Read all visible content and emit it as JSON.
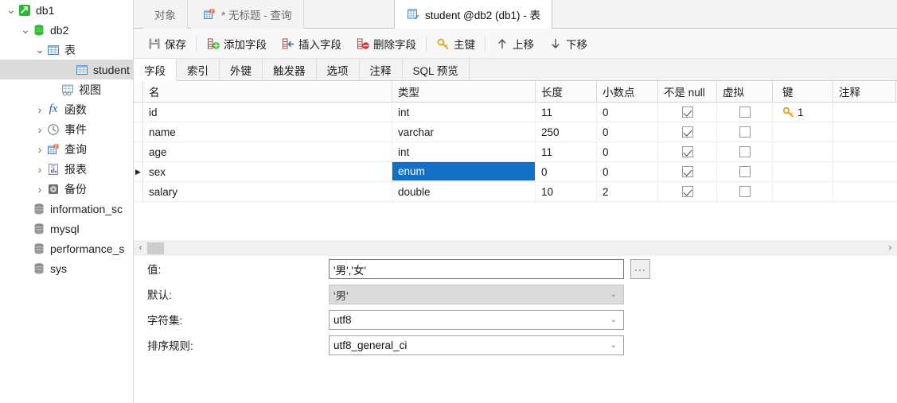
{
  "sidebar": {
    "items": [
      {
        "label": "db1",
        "icon": "connection-icon",
        "indent": 0,
        "twisty": "down",
        "selected": false
      },
      {
        "label": "db2",
        "icon": "database-icon",
        "indent": 1,
        "twisty": "down",
        "selected": false
      },
      {
        "label": "表",
        "icon": "table-folder-icon",
        "indent": 2,
        "twisty": "down",
        "selected": false
      },
      {
        "label": "student",
        "icon": "table-icon",
        "indent": 4,
        "twisty": "none",
        "selected": true
      },
      {
        "label": "视图",
        "icon": "view-icon",
        "indent": 3,
        "twisty": "none",
        "selected": false
      },
      {
        "label": "函数",
        "icon": "function-icon",
        "indent": 2,
        "twisty": "right",
        "selected": false
      },
      {
        "label": "事件",
        "icon": "event-clock-icon",
        "indent": 2,
        "twisty": "right",
        "selected": false
      },
      {
        "label": "查询",
        "icon": "query-icon",
        "indent": 2,
        "twisty": "right",
        "selected": false
      },
      {
        "label": "报表",
        "icon": "report-icon",
        "indent": 2,
        "twisty": "right",
        "selected": false
      },
      {
        "label": "备份",
        "icon": "backup-icon",
        "indent": 2,
        "twisty": "right",
        "selected": false
      },
      {
        "label": "information_sc",
        "icon": "database-gray-icon",
        "indent": 1,
        "twisty": "none",
        "selected": false
      },
      {
        "label": "mysql",
        "icon": "database-gray-icon",
        "indent": 1,
        "twisty": "none",
        "selected": false
      },
      {
        "label": "performance_s",
        "icon": "database-gray-icon",
        "indent": 1,
        "twisty": "none",
        "selected": false
      },
      {
        "label": "sys",
        "icon": "database-gray-icon",
        "indent": 1,
        "twisty": "none",
        "selected": false
      }
    ]
  },
  "tabs": [
    {
      "label": "对象",
      "icon": "none",
      "active": false
    },
    {
      "label": "* 无标题 - 查询",
      "icon": "query-icon",
      "active": false
    },
    {
      "label": "student @db2 (db1) - 表",
      "icon": "table-design-icon",
      "active": true
    }
  ],
  "toolbar": {
    "buttons": [
      {
        "label": "保存",
        "icon": "save-icon"
      },
      {
        "label": "添加字段",
        "icon": "add-field-icon"
      },
      {
        "label": "插入字段",
        "icon": "insert-field-icon"
      },
      {
        "label": "删除字段",
        "icon": "delete-field-icon"
      },
      {
        "label": "主键",
        "icon": "key-icon"
      },
      {
        "label": "上移",
        "icon": "arrow-up-icon"
      },
      {
        "label": "下移",
        "icon": "arrow-down-icon"
      }
    ]
  },
  "subtabs": [
    {
      "label": "字段",
      "active": true
    },
    {
      "label": "索引",
      "active": false
    },
    {
      "label": "外键",
      "active": false
    },
    {
      "label": "触发器",
      "active": false
    },
    {
      "label": "选项",
      "active": false
    },
    {
      "label": "注释",
      "active": false
    },
    {
      "label": "SQL 预览",
      "active": false
    }
  ],
  "grid": {
    "columns": [
      "名",
      "类型",
      "长度",
      "小数点",
      "不是 null",
      "虚拟",
      "键",
      "注释"
    ],
    "rows": [
      {
        "marker": "",
        "name": "id",
        "type": "int",
        "length": "11",
        "decimals": "0",
        "not_null": true,
        "virtual": false,
        "key": "1",
        "comment": "",
        "selected_type": false
      },
      {
        "marker": "",
        "name": "name",
        "type": "varchar",
        "length": "250",
        "decimals": "0",
        "not_null": true,
        "virtual": false,
        "key": "",
        "comment": "",
        "selected_type": false
      },
      {
        "marker": "",
        "name": "age",
        "type": "int",
        "length": "11",
        "decimals": "0",
        "not_null": true,
        "virtual": false,
        "key": "",
        "comment": "",
        "selected_type": false
      },
      {
        "marker": "▶",
        "name": "sex",
        "type": "enum",
        "length": "0",
        "decimals": "0",
        "not_null": true,
        "virtual": false,
        "key": "",
        "comment": "",
        "selected_type": true
      },
      {
        "marker": "",
        "name": "salary",
        "type": "double",
        "length": "10",
        "decimals": "2",
        "not_null": true,
        "virtual": false,
        "key": "",
        "comment": "",
        "selected_type": false
      }
    ]
  },
  "scrollbar": {
    "left_arrow": "‹",
    "right_arrow": "›"
  },
  "form": {
    "rows": [
      {
        "label": "值:",
        "value": "'男','女'",
        "control": "text",
        "disabled": false,
        "has_dots": true
      },
      {
        "label": "默认:",
        "value": "'男'",
        "control": "combo",
        "disabled": true,
        "has_dots": false
      },
      {
        "label": "字符集:",
        "value": "utf8",
        "control": "combo",
        "disabled": false,
        "has_dots": false
      },
      {
        "label": "排序规则:",
        "value": "utf8_general_ci",
        "control": "combo",
        "disabled": false,
        "has_dots": false
      }
    ],
    "dots_label": "···",
    "chevron": "⌄"
  },
  "colors": {
    "selection_blue": "#1271c6",
    "row_selected_gray": "#dcdcdc",
    "toolbar_bg": "#f8f8f8",
    "tabstrip_bg": "#f3f3f3"
  }
}
